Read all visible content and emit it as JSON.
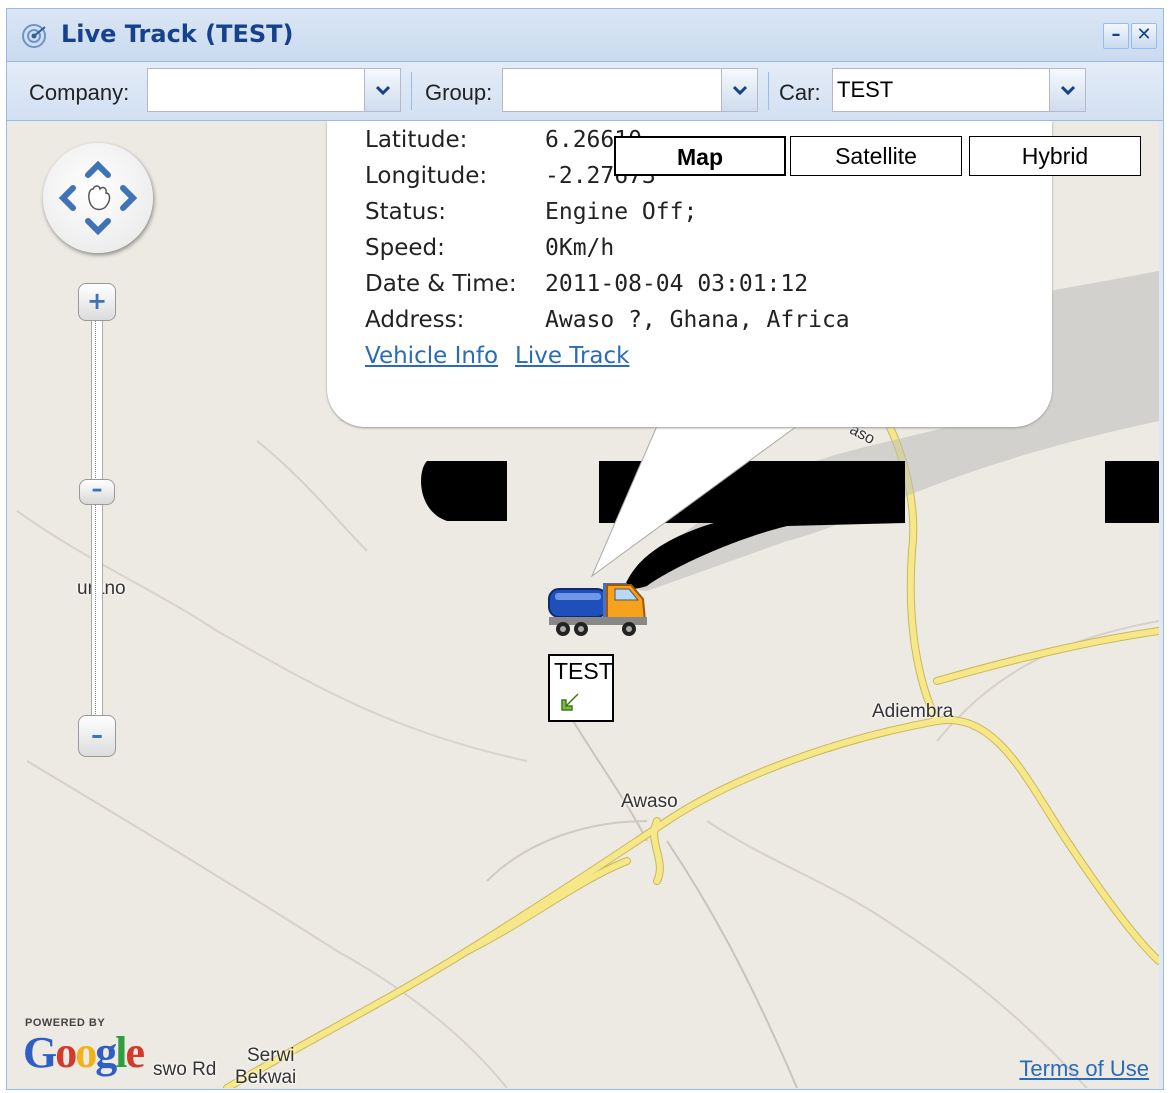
{
  "window": {
    "title": "Live Track (TEST)",
    "minimize_icon": "minimize-icon",
    "close_icon": "close-icon"
  },
  "toolbar": {
    "company_label": "Company:",
    "company_value": "",
    "group_label": "Group:",
    "group_value": "",
    "car_label": "Car:",
    "car_value": "TEST"
  },
  "map": {
    "type_buttons": [
      "Map",
      "Satellite",
      "Hybrid"
    ],
    "active_type": "Map",
    "places": {
      "urano": "urano",
      "adiembra": "Adiembra",
      "awaso": "Awaso",
      "serwi": "Serwi",
      "bekwai": "Bekwai",
      "wo_rd": "swo Rd",
      "road_label": "aso"
    },
    "powered_by": "POWERED BY",
    "logo_text": "Google",
    "terms": "Terms of Use",
    "vehicle_label": "TEST"
  },
  "info": {
    "latitude_label": "Latitude:",
    "latitude_value": "6.26610",
    "longitude_label": "Longitude:",
    "longitude_value": "-2.27673",
    "status_label": "Status:",
    "status_value": "Engine Off;",
    "speed_label": "Speed:",
    "speed_value": "0Km/h",
    "datetime_label": "Date & Time:",
    "datetime_value": "2011-08-04 03:01:12",
    "address_label": "Address:",
    "address_value": "Awaso ?, Ghana, Africa",
    "vehicle_info_link": "Vehicle Info",
    "live_track_link": "Live Track"
  },
  "colors": {
    "title_text": "#15428b",
    "panel_border": "#99bbe8",
    "road_major": "#f6e889",
    "map_bg": "#ede9e3",
    "link": "#2a6bb8"
  }
}
